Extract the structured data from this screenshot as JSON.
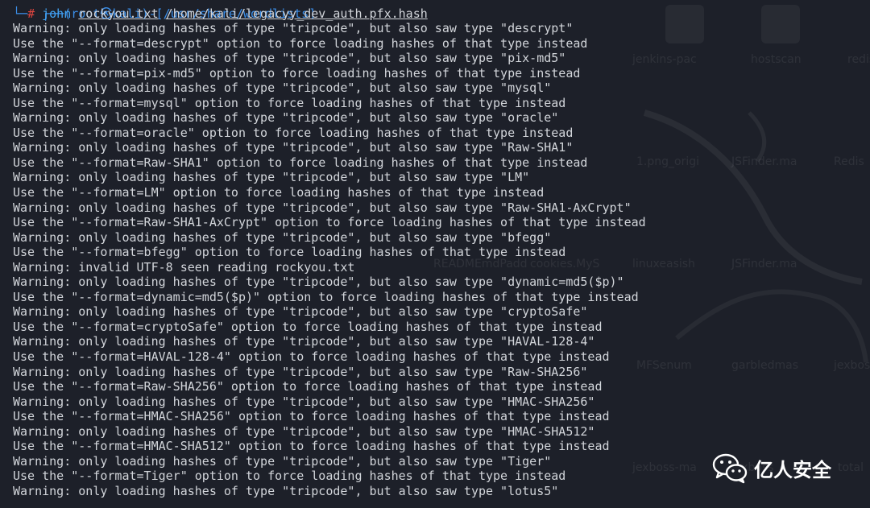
{
  "colors": {
    "background": "#1d2029",
    "text": "#d2d5da",
    "prompt_red": "#e0453f",
    "prompt_blue": "#3b8ee8"
  },
  "prompt": {
    "top_line": "┌──(root㉿kali)-[/usr/share/wordlists]",
    "corner": "└─",
    "hash": "#",
    "command": "john",
    "arg1": "rockyou.txt",
    "arg2": "/home/kali/legacyy_dev_auth.pfx.hash"
  },
  "output_lines": [
    "Warning: only loading hashes of type \"tripcode\", but also saw type \"descrypt\"",
    "Use the \"--format=descrypt\" option to force loading hashes of that type instead",
    "Warning: only loading hashes of type \"tripcode\", but also saw type \"pix-md5\"",
    "Use the \"--format=pix-md5\" option to force loading hashes of that type instead",
    "Warning: only loading hashes of type \"tripcode\", but also saw type \"mysql\"",
    "Use the \"--format=mysql\" option to force loading hashes of that type instead",
    "Warning: only loading hashes of type \"tripcode\", but also saw type \"oracle\"",
    "Use the \"--format=oracle\" option to force loading hashes of that type instead",
    "Warning: only loading hashes of type \"tripcode\", but also saw type \"Raw-SHA1\"",
    "Use the \"--format=Raw-SHA1\" option to force loading hashes of that type instead",
    "Warning: only loading hashes of type \"tripcode\", but also saw type \"LM\"",
    "Use the \"--format=LM\" option to force loading hashes of that type instead",
    "Warning: only loading hashes of type \"tripcode\", but also saw type \"Raw-SHA1-AxCrypt\"",
    "Use the \"--format=Raw-SHA1-AxCrypt\" option to force loading hashes of that type instead",
    "Warning: only loading hashes of type \"tripcode\", but also saw type \"bfegg\"",
    "Use the \"--format=bfegg\" option to force loading hashes of that type instead",
    "Warning: invalid UTF-8 seen reading rockyou.txt",
    "Warning: only loading hashes of type \"tripcode\", but also saw type \"dynamic=md5($p)\"",
    "Use the \"--format=dynamic=md5($p)\" option to force loading hashes of that type instead",
    "Warning: only loading hashes of type \"tripcode\", but also saw type \"cryptoSafe\"",
    "Use the \"--format=cryptoSafe\" option to force loading hashes of that type instead",
    "Warning: only loading hashes of type \"tripcode\", but also saw type \"HAVAL-128-4\"",
    "Use the \"--format=HAVAL-128-4\" option to force loading hashes of that type instead",
    "Warning: only loading hashes of type \"tripcode\", but also saw type \"Raw-SHA256\"",
    "Use the \"--format=Raw-SHA256\" option to force loading hashes of that type instead",
    "Warning: only loading hashes of type \"tripcode\", but also saw type \"HMAC-SHA256\"",
    "Use the \"--format=HMAC-SHA256\" option to force loading hashes of that type instead",
    "Warning: only loading hashes of type \"tripcode\", but also saw type \"HMAC-SHA512\"",
    "Use the \"--format=HMAC-SHA512\" option to force loading hashes of that type instead",
    "Warning: only loading hashes of type \"tripcode\", but also saw type \"Tiger\"",
    "Use the \"--format=Tiger\" option to force loading hashes of that type instead",
    "Warning: only loading hashes of type \"tripcode\", but also saw type \"lotus5\""
  ],
  "background_labels": [
    "jenkins-pac",
    "hostscan",
    "redis",
    "1.png_origi",
    "JSFinder.ma",
    "Redis",
    "READMEmdPadd",
    "cookies.MyS",
    "linuxeasish",
    "JSFinder.ma",
    "MFSenum",
    "garbledmas",
    "jexboss",
    "jexboss-ma",
    "jexboss",
    "total"
  ],
  "watermark": {
    "icon": "wechat-icon",
    "text": "亿人安全"
  }
}
